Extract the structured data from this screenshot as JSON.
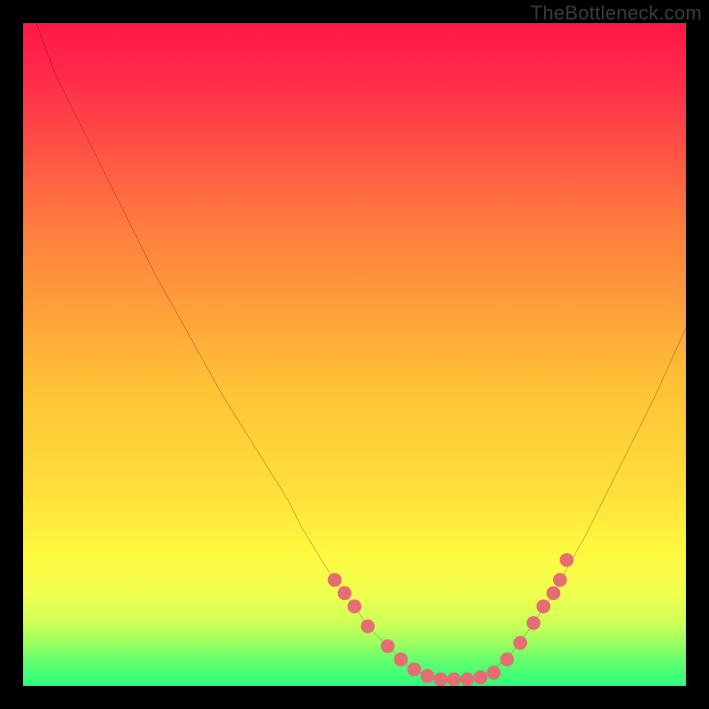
{
  "watermark": "TheBottleneck.com",
  "chart_data": {
    "type": "line",
    "title": "",
    "xlabel": "",
    "ylabel": "",
    "xlim": [
      0,
      100
    ],
    "ylim": [
      0,
      100
    ],
    "grid": false,
    "legend": false,
    "curve": {
      "name": "bottleneck-curve",
      "x": [
        2,
        5,
        10,
        15,
        20,
        25,
        30,
        35,
        40,
        42,
        45,
        47,
        50,
        52,
        55,
        58,
        60,
        62,
        65,
        68,
        70,
        73,
        76,
        80,
        85,
        90,
        95,
        100
      ],
      "y": [
        100,
        92,
        82,
        72,
        62,
        53,
        44,
        36,
        28,
        24,
        19,
        16,
        12,
        9,
        6,
        3,
        2,
        1,
        1,
        1,
        2,
        4,
        8,
        14,
        23,
        33,
        43,
        54
      ]
    },
    "marker_points": {
      "name": "marker-dots",
      "x": [
        47,
        48.5,
        50,
        52,
        55,
        57,
        59,
        61,
        63,
        65,
        67,
        69,
        71,
        73,
        75,
        77,
        78.5,
        80,
        81,
        82
      ],
      "y": [
        16,
        14,
        12,
        9,
        6,
        4,
        2.5,
        1.5,
        1,
        1,
        1,
        1.3,
        2,
        4,
        6.5,
        9.5,
        12,
        14,
        16,
        19
      ]
    },
    "colors": {
      "gradient_top": "#ff1846",
      "gradient_mid": "#ffd400",
      "gradient_bottom_yellow": "#f4ff52",
      "gradient_bottom_green": "#2bff7d",
      "curve_stroke": "#1a1a1a",
      "marker_fill": "#e46e74",
      "frame": "#000000"
    }
  }
}
